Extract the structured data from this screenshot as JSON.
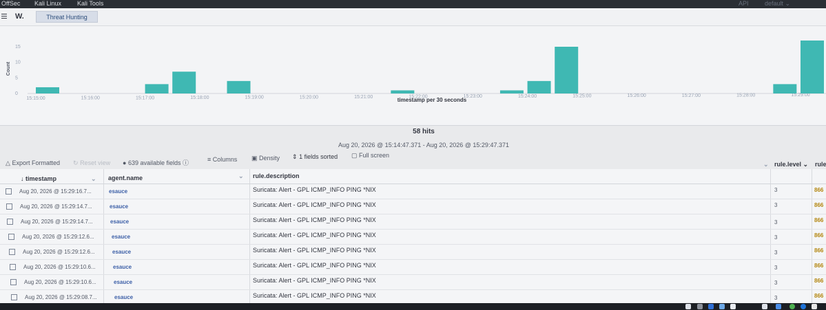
{
  "browser": {
    "bookmarks": [
      "OffSec",
      "Kali Linux",
      "Kali Tools"
    ],
    "right": [
      "API",
      "default"
    ]
  },
  "app": {
    "logo": "W.",
    "tab": "Threat Hunting"
  },
  "chart_data": {
    "type": "bar",
    "ylabel": "Count",
    "xlabel": "timestamp per 30 seconds",
    "ylim": [
      0,
      15
    ],
    "yticks": [
      "0",
      "5",
      "10",
      "15"
    ],
    "xticks": [
      "15:15:00",
      "15:16:00",
      "15:17:00",
      "15:18:00",
      "15:19:00",
      "15:20:00",
      "15:21:00",
      "15:22:00",
      "15:23:00",
      "15:24:00",
      "15:25:00",
      "15:26:00",
      "15:27:00",
      "15:28:00",
      "15:29:00"
    ],
    "x": [
      "15:15:00",
      "15:17:00",
      "15:17:30",
      "15:18:30",
      "15:21:30",
      "15:23:30",
      "15:24:00",
      "15:24:30",
      "15:28:30",
      "15:29:00"
    ],
    "values": [
      2,
      3,
      7,
      4,
      1,
      1,
      4,
      15,
      3,
      17
    ],
    "bar_color": "#3fb8b3"
  },
  "summary": {
    "hits": "58 hits",
    "range": "Aug 20, 2026 @ 15:14:47.371 - Aug 20, 2026 @ 15:29:47.371"
  },
  "toolbar": {
    "export": "Export Formatted",
    "reset": "Reset view",
    "fields": "639 available fields",
    "columns": "Columns",
    "density": "Density",
    "sorted": "1 fields sorted",
    "fullscreen": "Full screen"
  },
  "table": {
    "headers": [
      "timestamp",
      "agent.name",
      "rule.description",
      "rule.level",
      "rule.id"
    ],
    "rows": [
      {
        "timestamp": "Aug 20, 2026 @ 15:29:16.7...",
        "agent": "esauce",
        "desc": "Suricata: Alert - GPL ICMP_INFO PING *NIX",
        "level": "3",
        "id": "866"
      },
      {
        "timestamp": "Aug 20, 2026 @ 15:29:14.7...",
        "agent": "esauce",
        "desc": "Suricata: Alert - GPL ICMP_INFO PING *NIX",
        "level": "3",
        "id": "866"
      },
      {
        "timestamp": "Aug 20, 2026 @ 15:29:14.7...",
        "agent": "esauce",
        "desc": "Suricata: Alert - GPL ICMP_INFO PING *NIX",
        "level": "3",
        "id": "866"
      },
      {
        "timestamp": "Aug 20, 2026 @ 15:29:12.6...",
        "agent": "esauce",
        "desc": "Suricata: Alert - GPL ICMP_INFO PING *NIX",
        "level": "3",
        "id": "866"
      },
      {
        "timestamp": "Aug 20, 2026 @ 15:29:12.6...",
        "agent": "esauce",
        "desc": "Suricata: Alert - GPL ICMP_INFO PING *NIX",
        "level": "3",
        "id": "866"
      },
      {
        "timestamp": "Aug 20, 2026 @ 15:29:10.6...",
        "agent": "esauce",
        "desc": "Suricata: Alert - GPL ICMP_INFO PING *NIX",
        "level": "3",
        "id": "866"
      },
      {
        "timestamp": "Aug 20, 2026 @ 15:29:10.6...",
        "agent": "esauce",
        "desc": "Suricata: Alert - GPL ICMP_INFO PING *NIX",
        "level": "3",
        "id": "866"
      },
      {
        "timestamp": "Aug 20, 2026 @ 15:29:08.7...",
        "agent": "esauce",
        "desc": "Suricata: Alert - GPL ICMP_INFO PING *NIX",
        "level": "3",
        "id": "866"
      }
    ]
  }
}
